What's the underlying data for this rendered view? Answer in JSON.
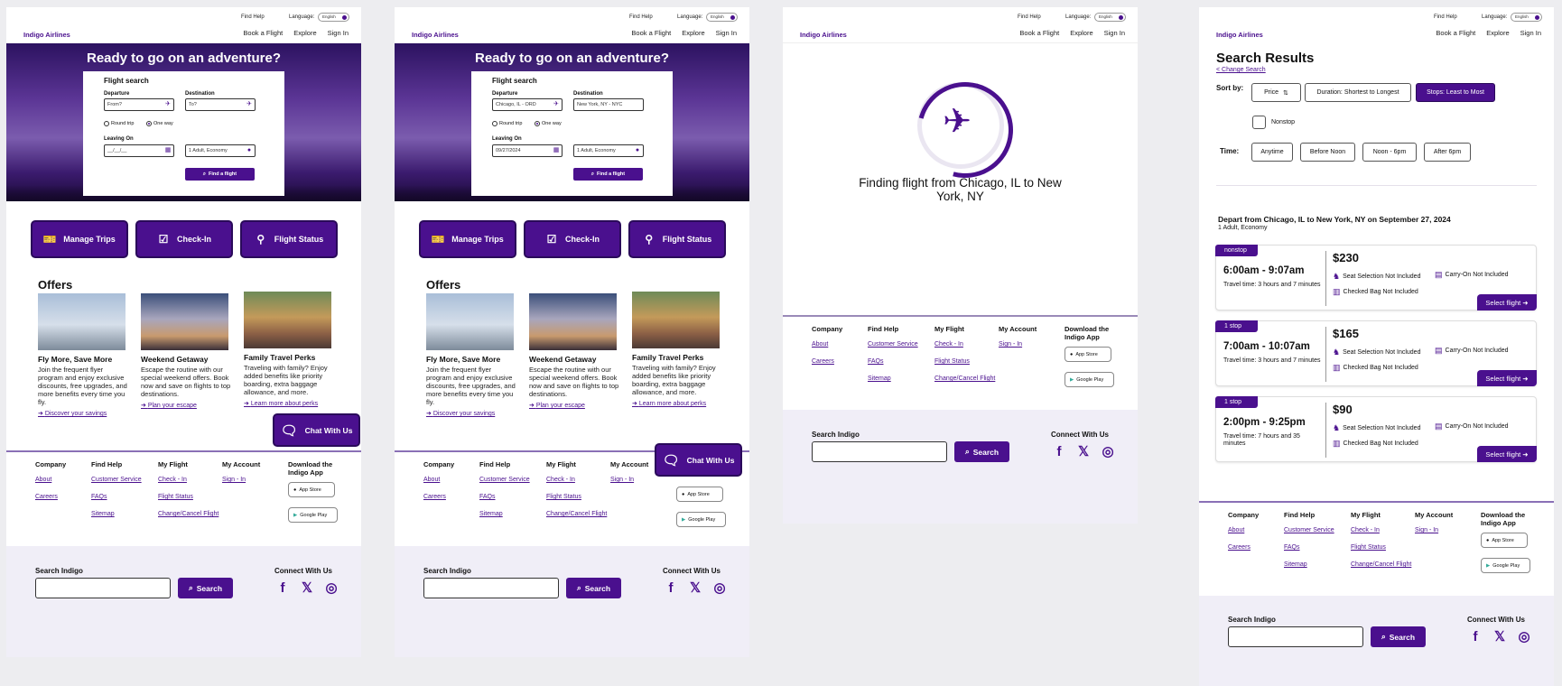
{
  "header": {
    "find_help": "Find Help",
    "language_label": "Language:",
    "language_value": "English",
    "logo": "Indigo Airlines",
    "nav": [
      "Book a Flight",
      "Explore",
      "Sign In"
    ]
  },
  "hero": {
    "title": "Ready to go on an adventure?",
    "card_title": "Flight search",
    "departure_label": "Departure",
    "destination_label": "Destination",
    "round_trip": "Round trip",
    "one_way": "One way",
    "leaving_on_label": "Leaving On",
    "find_button": "Find a flight",
    "empty": {
      "from": "From?",
      "to": "To?",
      "date": "__/__/__",
      "passengers": "1 Adult, Economy"
    },
    "filled": {
      "from": "Chicago, IL - ORD",
      "to": "New York, NY - NYC",
      "date": "09/27/2024",
      "passengers": "1 Adult, Economy"
    }
  },
  "quick_actions": [
    "Manage Trips",
    "Check-In",
    "Flight Status"
  ],
  "offers": {
    "title": "Offers",
    "items": [
      {
        "title": "Fly More, Save More",
        "desc": "Join the frequent flyer program and enjoy exclusive discounts, free upgrades, and more benefits every time you fly.",
        "link": "Discover your savings"
      },
      {
        "title": "Weekend Getaway",
        "desc": "Escape the routine with our special weekend offers. Book now and save on flights to top destinations.",
        "link": "Plan your escape"
      },
      {
        "title": "Family Travel Perks",
        "desc": "Traveling with family? Enjoy added benefits like priority boarding, extra baggage allowance, and more.",
        "link": "Learn more about perks"
      }
    ]
  },
  "chat_button": "Chat With Us",
  "footer": {
    "columns": [
      {
        "heading": "Company",
        "links": [
          "About",
          "Careers"
        ]
      },
      {
        "heading": "Find Help",
        "links": [
          "Customer Service",
          "FAQs",
          "Sitemap"
        ]
      },
      {
        "heading": "My Flight",
        "links": [
          "Check - In",
          "Flight Status",
          "Change/Cancel Flight"
        ]
      },
      {
        "heading": "My Account",
        "links": [
          "Sign - In"
        ]
      }
    ],
    "download_heading": "Download the Indigo App",
    "app_store": "App Store",
    "google_play": "Google Play",
    "search_label": "Search Indigo",
    "search_button": "Search",
    "connect_label": "Connect With Us"
  },
  "loading": {
    "text": "Finding flight from Chicago, IL to New York, NY"
  },
  "results": {
    "title": "Search Results",
    "change_search": "< Change Search",
    "sort_label": "Sort by:",
    "sort_options": [
      "Price",
      "Duration: Shortest to Longest",
      "Stops: Least to Most"
    ],
    "nonstop_label": "Nonstop",
    "time_label": "Time:",
    "time_options": [
      "Anytime",
      "Before Noon",
      "Noon - 6pm",
      "After 6pm"
    ],
    "route_heading": "Depart from Chicago, IL to New York, NY on September 27, 2024",
    "route_sub": "1 Adult, Economy",
    "seat": "Seat Selection Not Included",
    "carry": "Carry-On Not Included",
    "checked": "Checked Bag Not Included",
    "select": "Select flight",
    "flights": [
      {
        "badge": "nonstop",
        "times": "6:00am - 9:07am",
        "travel": "Travel time: 3 hours and 7 minutes",
        "price": "$230"
      },
      {
        "badge": "1 stop",
        "times": "7:00am - 10:07am",
        "travel": "Travel time: 3 hours and 7 minutes",
        "price": "$165"
      },
      {
        "badge": "1 stop",
        "times": "2:00pm - 9:25pm",
        "travel": "Travel time: 7 hours and 35 minutes",
        "price": "$90"
      }
    ]
  },
  "colors": {
    "brand": "#4a108e",
    "footer_bg": "#f0eef7"
  }
}
